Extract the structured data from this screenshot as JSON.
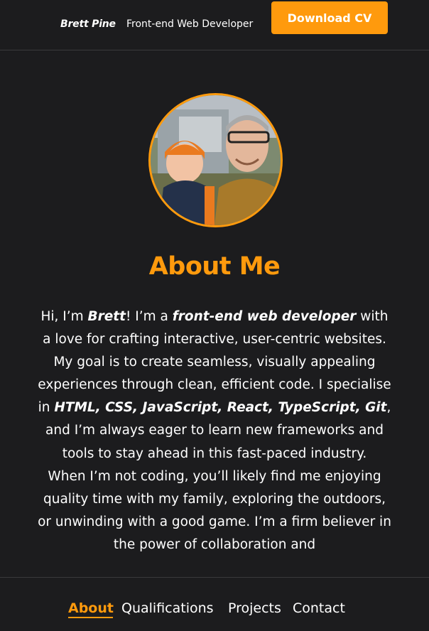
{
  "header": {
    "name": "Brett Pine",
    "role": "Front-end Web Developer",
    "cv_button": "Download CV"
  },
  "profile": {
    "avatar_icon": "profile-photo"
  },
  "about": {
    "title": "About Me",
    "p1": {
      "t1": "Hi, I’m ",
      "b1": "Brett",
      "t2": "! I’m a ",
      "b2": "front-end web developer",
      "t3": " with a love for crafting interactive, user-centric websites. My goal is to create seamless, visually appealing experiences through clean, efficient code. I specialise in ",
      "b3": "HTML, CSS, JavaScript, React, TypeScript, Git",
      "t4": ", and I’m always eager to learn new frameworks and tools to stay ahead in this fast-paced industry."
    },
    "p2": "When I’m not coding, you’ll likely find me enjoying quality time with my family, exploring the outdoors, or unwinding with a good game. I’m a firm believer in the power of collaboration and"
  },
  "nav": {
    "items": [
      "About",
      "Qualifications",
      "Projects",
      "Contact"
    ],
    "active": "About"
  },
  "colors": {
    "accent": "#ff9a0d",
    "background": "#1c1c1e"
  }
}
